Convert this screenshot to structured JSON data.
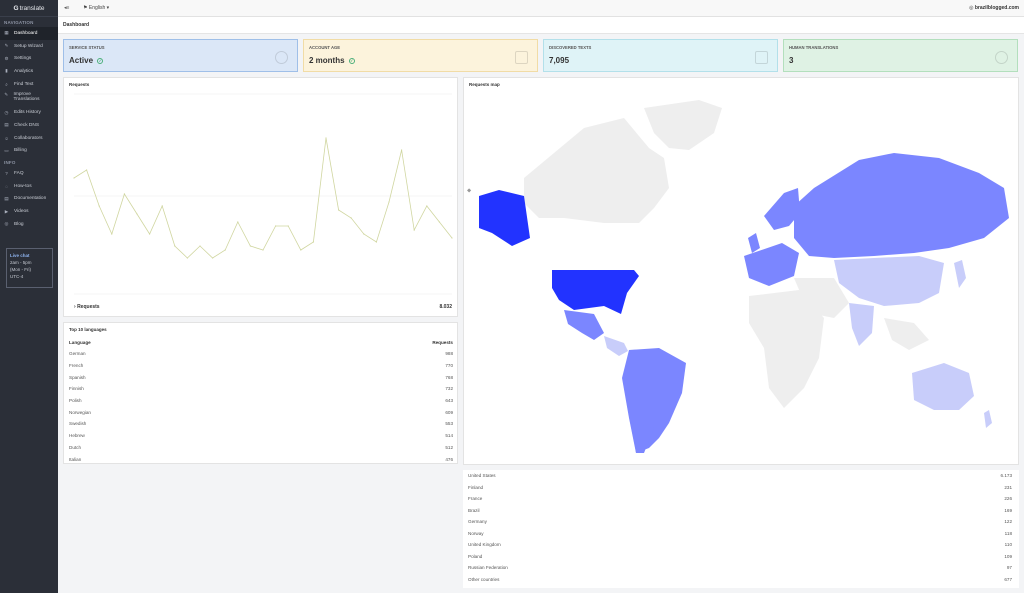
{
  "brand": {
    "logo_g": "G",
    "logo_text": "translate"
  },
  "sidebar": {
    "navigation_header": "NAVIGATION",
    "nav": [
      {
        "label": "Dashboard",
        "icon": "dashboard-icon",
        "glyph": "▦"
      },
      {
        "label": "Setup Wizard",
        "icon": "wand-icon",
        "glyph": "✎"
      },
      {
        "label": "Settings",
        "icon": "gear-icon",
        "glyph": "⚙"
      },
      {
        "label": "Analytics",
        "icon": "chart-icon",
        "glyph": "▮"
      },
      {
        "label": "Find Text",
        "icon": "search-icon",
        "glyph": "⌕"
      },
      {
        "label": "Improve Translations",
        "icon": "pencil-icon",
        "glyph": "✎"
      },
      {
        "label": "Edits History",
        "icon": "history-icon",
        "glyph": "◷"
      },
      {
        "label": "Check DNS",
        "icon": "dns-icon",
        "glyph": "▤"
      },
      {
        "label": "Collaborators",
        "icon": "users-icon",
        "glyph": "☺"
      },
      {
        "label": "Billing",
        "icon": "billing-icon",
        "glyph": "▭"
      }
    ],
    "info_header": "INFO",
    "info": [
      {
        "label": "FAQ",
        "icon": "question-icon",
        "glyph": "?"
      },
      {
        "label": "How-tos",
        "icon": "book-icon",
        "glyph": "◌"
      },
      {
        "label": "Documentation",
        "icon": "doc-icon",
        "glyph": "▤"
      },
      {
        "label": "Videos",
        "icon": "video-icon",
        "glyph": "▶"
      },
      {
        "label": "Blog",
        "icon": "blog-icon",
        "glyph": "◎"
      }
    ],
    "live_chat": {
      "title": "Live chat",
      "hours": "2am - 5pm",
      "days": "(Mon - Fri)",
      "tz": "UTC-4"
    }
  },
  "topbar": {
    "language": "English",
    "site": "brazilblogged.com"
  },
  "page": {
    "title": "Dashboard"
  },
  "stats": [
    {
      "label": "SERVICE STATUS",
      "value": "Active",
      "check": "✓"
    },
    {
      "label": "ACCOUNT AGE",
      "value": "2 months",
      "check": "✓"
    },
    {
      "label": "DISCOVERED TEXTS",
      "value": "7,095"
    },
    {
      "label": "HUMAN TRANSLATIONS",
      "value": "3"
    }
  ],
  "requests_panel": {
    "title": "Requests",
    "legend": "Requests",
    "total": "8.032",
    "colors": {
      "line": "#d0d6a0"
    },
    "chart_data": {
      "type": "line",
      "title": "Requests",
      "xlabel": "",
      "ylabel": "",
      "grid": true,
      "legend": "bottom-left",
      "series": [
        {
          "name": "Requests",
          "values": [
            0.58,
            0.62,
            0.44,
            0.3,
            0.5,
            0.4,
            0.3,
            0.44,
            0.24,
            0.18,
            0.24,
            0.18,
            0.22,
            0.36,
            0.24,
            0.22,
            0.34,
            0.34,
            0.22,
            0.26,
            0.78,
            0.42,
            0.38,
            0.3,
            0.26,
            0.46,
            0.72,
            0.32,
            0.44,
            0.36,
            0.28
          ]
        }
      ]
    }
  },
  "languages_panel": {
    "title": "Top 10 languages",
    "header": {
      "language": "Language",
      "requests": "Requests"
    },
    "rows": [
      {
        "language": "German",
        "requests": "988"
      },
      {
        "language": "French",
        "requests": "770"
      },
      {
        "language": "Spanish",
        "requests": "768"
      },
      {
        "language": "Finnish",
        "requests": "732"
      },
      {
        "language": "Polish",
        "requests": "643"
      },
      {
        "language": "Norwegian",
        "requests": "609"
      },
      {
        "language": "Swedish",
        "requests": "553"
      },
      {
        "language": "Hebrew",
        "requests": "514"
      },
      {
        "language": "Dutch",
        "requests": "512"
      },
      {
        "language": "Italian",
        "requests": "476"
      }
    ]
  },
  "map_panel": {
    "title": "Requests map",
    "colors": {
      "high": "#2233ff",
      "mid": "#7b86ff",
      "low": "#c8cdfa",
      "none": "#eeeeee"
    }
  },
  "countries": [
    {
      "name": "United States",
      "value": "6.173"
    },
    {
      "name": "Finland",
      "value": "231"
    },
    {
      "name": "France",
      "value": "226"
    },
    {
      "name": "Brazil",
      "value": "169"
    },
    {
      "name": "Germany",
      "value": "122"
    },
    {
      "name": "Norway",
      "value": "118"
    },
    {
      "name": "United Kingdom",
      "value": "110"
    },
    {
      "name": "Poland",
      "value": "109"
    },
    {
      "name": "Russian Federation",
      "value": "97"
    },
    {
      "name": "Other countries",
      "value": "677"
    }
  ]
}
